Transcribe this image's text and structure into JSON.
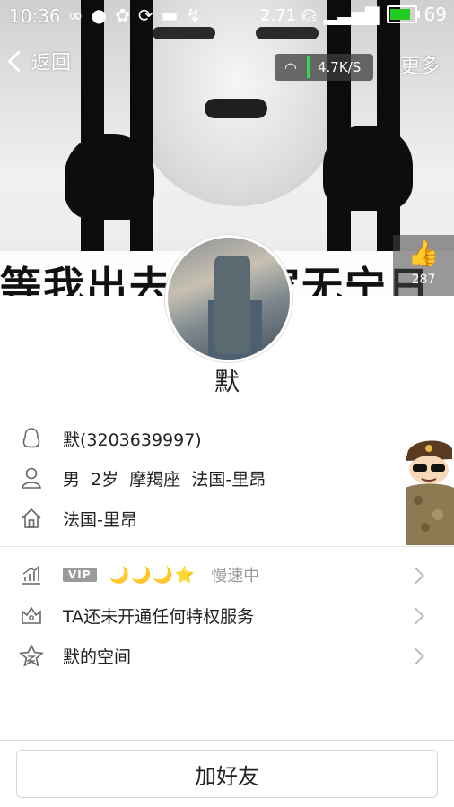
{
  "status_bar": {
    "time": "10:36",
    "speed": "2.71",
    "speed_unit": "K/s",
    "battery": "69",
    "icons": [
      "infinity-icon",
      "chat-icon",
      "paw-icon",
      "sync-icon",
      "message-icon",
      "missed-call-icon",
      "wifi-icon",
      "signal-icon",
      "battery-icon"
    ]
  },
  "nav": {
    "back_label": "返回",
    "more_label": "更多",
    "network_speed": "4.7K/S"
  },
  "cover": {
    "slogan": "等我出去了你家无宁日",
    "likes": "287"
  },
  "profile": {
    "name": "默",
    "qq": "默(3203639997)",
    "gender": "男",
    "age": "2岁",
    "zodiac": "摩羯座",
    "location_line": "法国-里昂",
    "hometown": "法国-里昂"
  },
  "vip": {
    "badge": "VIP",
    "moons": "🌙🌙🌙⭐",
    "status": "慢速中"
  },
  "privilege": "TA还未开通任何特权服务",
  "space": "默的空间",
  "add_friend": "加好友",
  "colors": {
    "accent_green": "#22cc22",
    "moon_yellow": "#f0b400"
  }
}
